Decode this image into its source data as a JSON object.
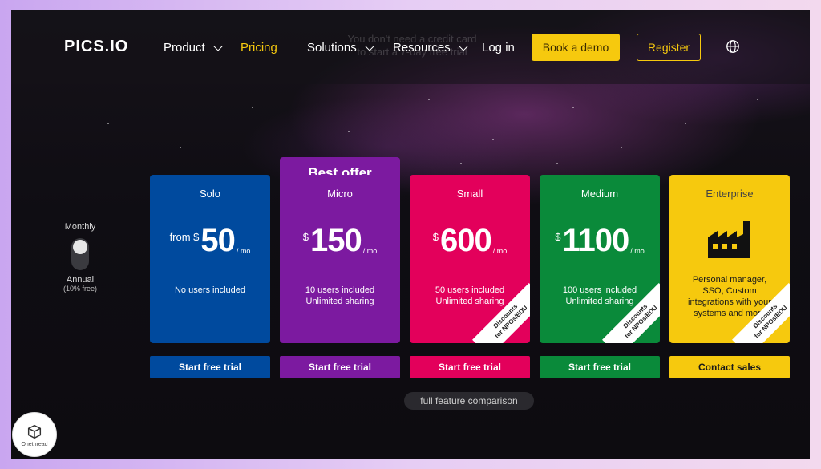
{
  "colors": {
    "solo": "#004a9e",
    "micro": "#7c1aa0",
    "small": "#e3005b",
    "medium": "#0a8a3a",
    "enterprise": "#f6c90e",
    "accent": "#f6c90e"
  },
  "ghost": {
    "line1": "You don't need a credit card",
    "line2": "to start a 7-day free trial"
  },
  "nav": {
    "logo": "PICS.IO",
    "items": [
      {
        "label": "Product"
      },
      {
        "label": "Pricing"
      },
      {
        "label": "Solutions"
      },
      {
        "label": "Resources"
      },
      {
        "label": "Log in"
      }
    ],
    "demo": "Book a demo",
    "register": "Register",
    "globe_icon": "globe-icon"
  },
  "toggle": {
    "monthly": "Monthly",
    "annual": "Annual",
    "annual_sub": "(10% free)"
  },
  "best_offer": "Best offer",
  "plans": [
    {
      "name": "Solo",
      "prefix": "from $",
      "price": "50",
      "unit": "/ mo",
      "desc1": "No users included",
      "desc2": "",
      "cta": "Start free trial"
    },
    {
      "name": "Micro",
      "prefix": "$",
      "price": "150",
      "unit": "/ mo",
      "desc1": "10 users included",
      "desc2": "Unlimited sharing",
      "cta": "Start free trial"
    },
    {
      "name": "Small",
      "prefix": "$",
      "price": "600",
      "unit": "/ mo",
      "desc1": "50 users included",
      "desc2": "Unlimited sharing",
      "cta": "Start free trial",
      "ribbon1": "Discounts",
      "ribbon2": "for NPOs/EDU"
    },
    {
      "name": "Medium",
      "prefix": "$",
      "price": "1100",
      "unit": "/ mo",
      "desc1": "100 users included",
      "desc2": "Unlimited sharing",
      "cta": "Start free trial",
      "ribbon1": "Discounts",
      "ribbon2": "for NPOs/EDU"
    },
    {
      "name": "Enterprise",
      "desc1": "Personal manager,",
      "desc2": "SSO, Custom",
      "desc3": "integrations with your",
      "desc4": "systems and more",
      "cta": "Contact sales",
      "ribbon1": "Discounts",
      "ribbon2": "for NPOs/EDU"
    }
  ],
  "compare": "full feature comparison",
  "watermark": "Onethread"
}
